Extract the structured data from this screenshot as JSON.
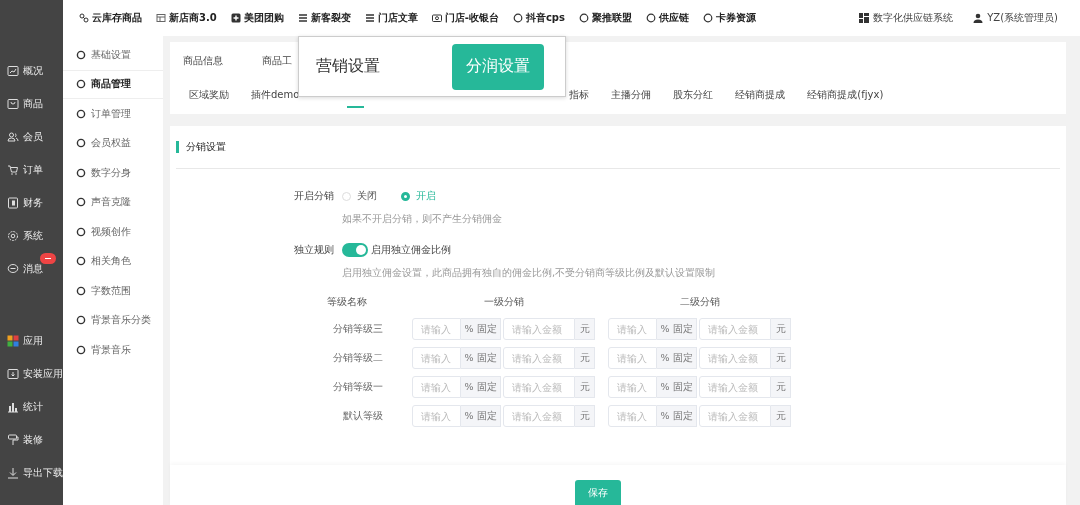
{
  "top_nav": {
    "items": [
      {
        "label": "云库存商品",
        "kind": "link"
      },
      {
        "label": "新店商3.0",
        "kind": "store"
      },
      {
        "label": "美团团购",
        "kind": "plus"
      },
      {
        "label": "新客裂变",
        "kind": "list"
      },
      {
        "label": "门店文章",
        "kind": "list"
      },
      {
        "label": "门店-收银台",
        "kind": "cashier"
      },
      {
        "label": "抖音cps",
        "kind": "circle"
      },
      {
        "label": "聚推联盟",
        "kind": "circle"
      },
      {
        "label": "供应链",
        "kind": "circle"
      },
      {
        "label": "卡券资源",
        "kind": "circle"
      }
    ],
    "org": "数字化供应链系统",
    "user": "YZ(系统管理员)"
  },
  "sidebar": {
    "items": [
      {
        "label": "概况",
        "kind": "chart",
        "badge": false
      },
      {
        "label": "商品",
        "kind": "bag",
        "badge": false
      },
      {
        "label": "会员",
        "kind": "users",
        "badge": false
      },
      {
        "label": "订单",
        "kind": "cart",
        "badge": false
      },
      {
        "label": "财务",
        "kind": "wallet",
        "badge": false
      },
      {
        "label": "系统",
        "kind": "gear",
        "badge": false
      },
      {
        "label": "消息",
        "kind": "chat",
        "badge": true
      },
      {
        "label": "应用",
        "kind": "apps",
        "badge": false
      },
      {
        "label": "安装应用",
        "kind": "install",
        "badge": false
      },
      {
        "label": "统计",
        "kind": "bars",
        "badge": false
      },
      {
        "label": "装修",
        "kind": "brush",
        "badge": false
      },
      {
        "label": "导出下载",
        "kind": "download",
        "badge": false
      }
    ]
  },
  "sub_nav": {
    "items": [
      {
        "label": "基础设置",
        "selected": false
      },
      {
        "label": "商品管理",
        "selected": true
      },
      {
        "label": "订单管理",
        "selected": false
      },
      {
        "label": "会员权益",
        "selected": false
      },
      {
        "label": "数字分身",
        "selected": false
      },
      {
        "label": "声音克隆",
        "selected": false
      },
      {
        "label": "视频创作",
        "selected": false
      },
      {
        "label": "相关角色",
        "selected": false
      },
      {
        "label": "字数范围",
        "selected": false
      },
      {
        "label": "背景音乐分类",
        "selected": false
      },
      {
        "label": "背景音乐",
        "selected": false
      }
    ]
  },
  "tabs": {
    "row_1": [
      "商品信息",
      "商品工"
    ],
    "row_2_left": [
      "区域奖励",
      "插件demo"
    ],
    "row_2_right": [
      "指标",
      "主播分佣",
      "股东分红",
      "经销商提成",
      "经销商提成(fjyx)"
    ]
  },
  "popup": {
    "title": "营销设置",
    "button": "分润设置"
  },
  "section_title": "分销设置",
  "enable_distribution": {
    "label": "开启分销",
    "options": [
      {
        "label": "关闭",
        "selected": false
      },
      {
        "label": "开启",
        "selected": true
      }
    ],
    "hint": "如果不开启分销，则不产生分销佣金"
  },
  "independent_rule": {
    "label": "独立规则",
    "on": true,
    "switch_label": "启用独立佣金比例",
    "hint": "启用独立佣金设置，此商品拥有独自的佣金比例,不受分销商等级比例及默认设置限制"
  },
  "levels": {
    "headings": {
      "name": "等级名称",
      "tiers": [
        "一级分销",
        "二级分销"
      ]
    },
    "rows": [
      {
        "name": "分销等级三",
        "cells": [
          {
            "rate_placeholder": "请输入",
            "rate_unit": "% 固定",
            "amount_placeholder": "请输入金额",
            "amount_unit": "元"
          },
          {
            "rate_placeholder": "请输入",
            "rate_unit": "% 固定",
            "amount_placeholder": "请输入金额",
            "amount_unit": "元"
          }
        ]
      },
      {
        "name": "分销等级二",
        "cells": [
          {
            "rate_placeholder": "请输入",
            "rate_unit": "% 固定",
            "amount_placeholder": "请输入金额",
            "amount_unit": "元"
          },
          {
            "rate_placeholder": "请输入",
            "rate_unit": "% 固定",
            "amount_placeholder": "请输入金额",
            "amount_unit": "元"
          }
        ]
      },
      {
        "name": "分销等级一",
        "cells": [
          {
            "rate_placeholder": "请输入",
            "rate_unit": "% 固定",
            "amount_placeholder": "请输入金额",
            "amount_unit": "元"
          },
          {
            "rate_placeholder": "请输入",
            "rate_unit": "% 固定",
            "amount_placeholder": "请输入金额",
            "amount_unit": "元"
          }
        ]
      },
      {
        "name": "默认等级",
        "cells": [
          {
            "rate_placeholder": "请输入",
            "rate_unit": "% 固定",
            "amount_placeholder": "请输入金额",
            "amount_unit": "元"
          },
          {
            "rate_placeholder": "请输入",
            "rate_unit": "% 固定",
            "amount_placeholder": "请输入金额",
            "amount_unit": "元"
          }
        ]
      }
    ]
  },
  "save_button": "保存"
}
